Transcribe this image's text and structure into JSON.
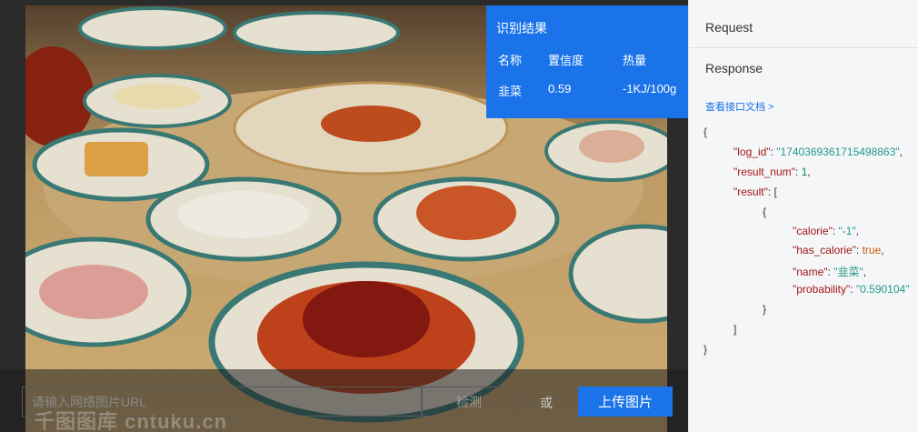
{
  "upload": {
    "url_placeholder": "请输入网络图片URL",
    "detect_label": "检测",
    "or_label": "或",
    "upload_label": "上传图片",
    "watermark": "千图图库 cntuku.cn"
  },
  "result_panel": {
    "title": "识别结果",
    "headers": [
      "名称",
      "置信度",
      "热量"
    ],
    "row": [
      "韭菜",
      "0.59",
      "-1KJ/100g"
    ]
  },
  "api": {
    "request_label": "Request",
    "response_label": "Response",
    "doc_link": "查看接口文档 >"
  },
  "response_json": {
    "open_brace": "{",
    "log_id_key": "\"log_id\"",
    "log_id_val": "\"1740369361715498863\"",
    "result_num_key": "\"result_num\"",
    "result_num_val": "1",
    "result_key": "\"result\"",
    "open_bracket": "[",
    "item_open": "{",
    "calorie_key": "\"calorie\"",
    "calorie_val": "\"-1\"",
    "has_calorie_key": "\"has_calorie\"",
    "has_calorie_val": "true",
    "name_key": "\"name\"",
    "name_val": "\"韭菜\"",
    "probability_key": "\"probability\"",
    "probability_val": "\"0.590104\"",
    "item_close": "}",
    "close_bracket": "]",
    "close_brace": "}"
  }
}
